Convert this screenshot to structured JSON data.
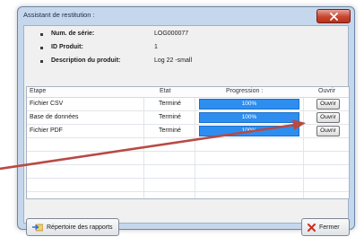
{
  "window": {
    "title": "Assistant de restitution :"
  },
  "info": [
    {
      "label": "Num. de série:",
      "value": "LOG000077"
    },
    {
      "label": "ID Produit:",
      "value": "1"
    },
    {
      "label": "Description du produit:",
      "value": "Log 22 -small"
    }
  ],
  "table": {
    "headers": {
      "step": "Etape",
      "state": "Etat",
      "progress": "Progression :",
      "open": "Ouvrir"
    },
    "rows": [
      {
        "step": "Fichier CSV",
        "state": "Terminé",
        "progress_label": "100%",
        "progress": 1.0,
        "button": "Ouvrir"
      },
      {
        "step": "Base de données",
        "state": "Terminé",
        "progress_label": "100%",
        "progress": 1.0,
        "button": "Ouvrir"
      },
      {
        "step": "Fichier PDF",
        "state": "Terminé",
        "progress_label": "100%",
        "progress": 1.0,
        "button": "Ouvrir"
      }
    ]
  },
  "footer": {
    "reports_button": "Répertoire des rapports",
    "close_button": "Fermer"
  },
  "colors": {
    "progress_fill": "#2e8ef0",
    "annotation_arrow": "#b84a45",
    "close_x": "#d22b1b"
  },
  "icons": {
    "reports": "arrow-folder-icon",
    "close": "red-x-icon",
    "window_close": "close-icon"
  }
}
